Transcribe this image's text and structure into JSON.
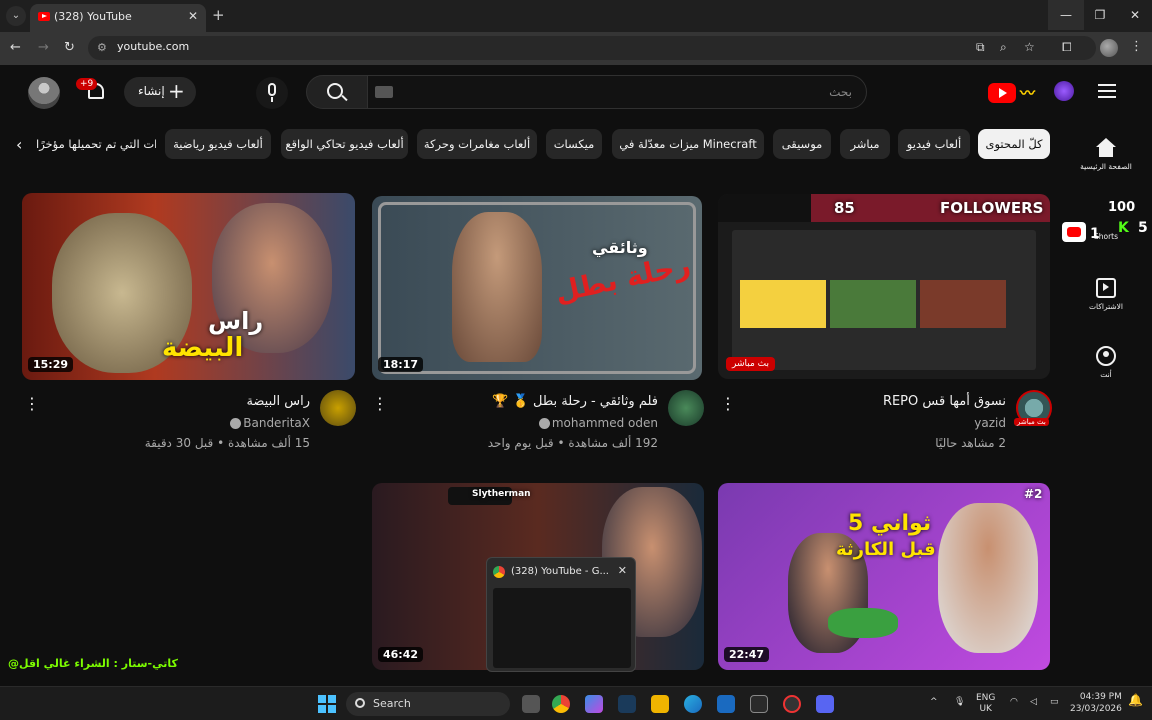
{
  "browser": {
    "tab_title": "(328) YouTube",
    "url": "youtube.com"
  },
  "header": {
    "notifications_badge": "+9",
    "create_label": "إنشاء",
    "search_placeholder": "بحث"
  },
  "chips": [
    "كلّ المحتوى",
    "ألعاب فيديو",
    "مباشر",
    "موسيقى",
    "ميزات معدّلة في Minecraft",
    "ميكسات",
    "ألعاب مغامرات وحركة",
    "ألعاب فيديو تحاكي الواقع",
    "ألعاب فيديو رياضية",
    "القنوات التي تم تحميلها مؤخرًا"
  ],
  "rail": {
    "home": "الصفحة الرئيسية",
    "shorts": "Shorts",
    "subscriptions": "الاشتراكات",
    "you": "أنت"
  },
  "videos": [
    {
      "title": "نسوق أمها قس REPO",
      "channel": "yazid",
      "meta": "2 مشاهد حاليًا",
      "badge": "بث مباشر",
      "avatar_badge": "بث مباشر",
      "thumb_text": {
        "followers": "FOLLOWERS",
        "count": "85"
      }
    },
    {
      "title": "فلم وثائقي - رحلة بطل 🥇 🏆",
      "channel": "mohammed oden",
      "meta": "192 ألف مشاهدة • قبل يوم واحد",
      "duration": "18:17",
      "thumb_text": {
        "line1": "وثائقي",
        "line2": "رحلة بطل"
      }
    },
    {
      "title": "راس البيضة",
      "channel": "BanderitaX",
      "meta": "15 ألف مشاهدة • قبل 30 دقيقة",
      "duration": "15:29",
      "thumb_text": {
        "line1": "راس",
        "line2": "البيضة"
      }
    },
    {
      "duration": "22:47",
      "thumb_text": {
        "line1": "5 ثواني",
        "line2": "قبل الكارثة",
        "tag": "#2"
      }
    },
    {
      "duration": "46:42",
      "thumb_text": {
        "channel_tag": "Slytherman"
      }
    }
  ],
  "shorts_overlay": {
    "count_a": "100",
    "count_b": "1",
    "count_c": "5"
  },
  "preview": {
    "title": "(328) YouTube - G..."
  },
  "overlay_text": {
    "part_a": "@كاتي-ستار : الشراء غالي اقل",
    "part_b": ""
  },
  "taskbar": {
    "search_label": "Search",
    "lang_line1": "ENG",
    "lang_line2": "UK",
    "time": "04:39 PM",
    "date": "23/03/2026"
  },
  "colors": {
    "background": "#0f0f0f",
    "chip": "#272727",
    "accent_red": "#ff0000",
    "secondary_text": "#aaaaaa"
  }
}
